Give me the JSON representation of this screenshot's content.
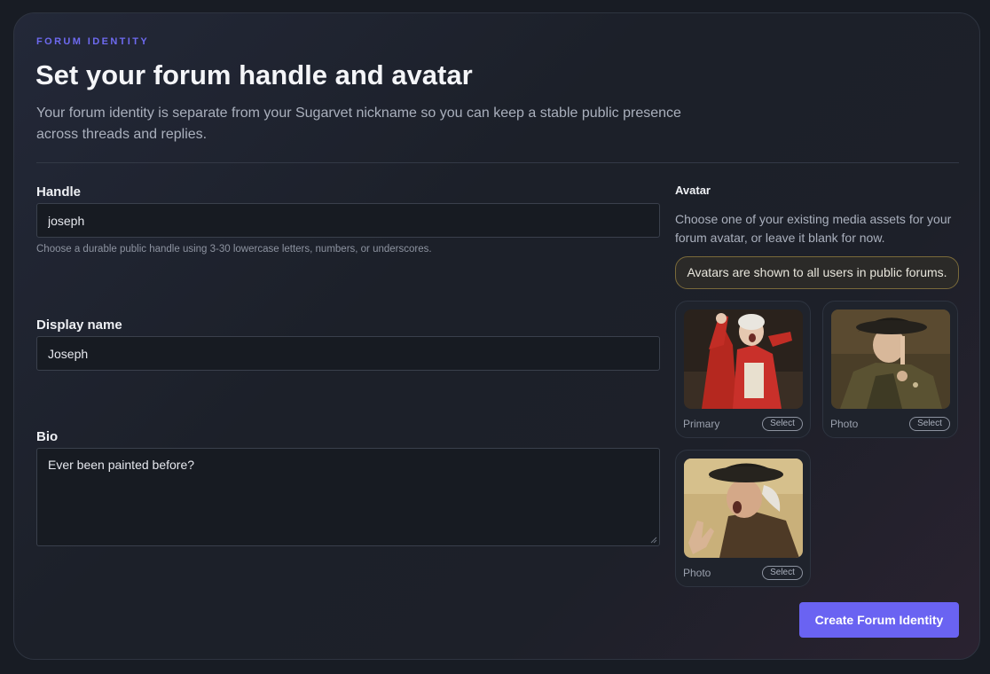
{
  "header": {
    "eyebrow": "FORUM IDENTITY",
    "title": "Set your forum handle and avatar",
    "subtitle": "Your forum identity is separate from your Sugarvet nickname so you can keep a stable public presence across threads and replies."
  },
  "form": {
    "handle": {
      "label": "Handle",
      "value": "joseph",
      "hint": "Choose a durable public handle using 3-30 lowercase letters, numbers, or underscores."
    },
    "display_name": {
      "label": "Display name",
      "value": "Joseph"
    },
    "bio": {
      "label": "Bio",
      "value": "Ever been painted before?"
    }
  },
  "avatar": {
    "label": "Avatar",
    "description": "Choose one of your existing media assets for your forum avatar, or leave it blank for now.",
    "notice": "Avatars are shown to all users in public forums.",
    "assets": [
      {
        "label": "Primary",
        "select_label": "Select"
      },
      {
        "label": "Photo",
        "select_label": "Select"
      },
      {
        "label": "Photo",
        "select_label": "Select"
      }
    ]
  },
  "actions": {
    "submit_label": "Create Forum Identity"
  },
  "colors": {
    "accent": "#6a63f2",
    "eyebrow": "#6e6af0",
    "notice_border": "#7a6a3a"
  }
}
